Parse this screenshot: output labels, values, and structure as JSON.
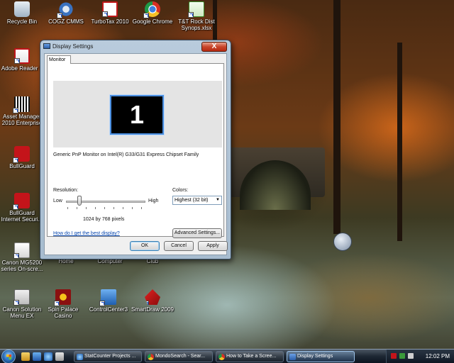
{
  "desktop": {
    "icons": [
      {
        "label": "Recycle Bin"
      },
      {
        "label": "COGZ CMMS"
      },
      {
        "label": "TurboTax 2010"
      },
      {
        "label": "Google Chrome"
      },
      {
        "label": "T&T Rock Dist Synops.xlsx"
      },
      {
        "label": "Adobe Reader 9"
      },
      {
        "label": "Asset Manager 2010 Enterprise"
      },
      {
        "label": "BullGuard"
      },
      {
        "label": "BullGuard Internet Securi..."
      },
      {
        "label": "Canon MG5200 series On-scre..."
      },
      {
        "label": "Home"
      },
      {
        "label": "Computer"
      },
      {
        "label": "Club"
      },
      {
        "label": "Canon Solution Menu EX"
      },
      {
        "label": "Spin Palace Casino"
      },
      {
        "label": "ControlCenter3"
      },
      {
        "label": "SmartDraw 2009"
      }
    ]
  },
  "dialog": {
    "title": "Display Settings",
    "close_label": "X",
    "tab_label": "Monitor",
    "monitor_number": "1",
    "monitor_description": "Generic PnP Monitor on Intel(R) G33/G31 Express Chipset Family",
    "resolution_label": "Resolution:",
    "low_label": "Low",
    "high_label": "High",
    "resolution_value": "1024 by 768 pixels",
    "colors_label": "Colors:",
    "colors_value": "Highest (32 bit)",
    "help_link": "How do I get the best display?",
    "advanced_button": "Advanced Settings...",
    "ok_button": "OK",
    "cancel_button": "Cancel",
    "apply_button": "Apply"
  },
  "taskbar": {
    "buttons": [
      {
        "label": "StatCounter Projects ...",
        "active": false
      },
      {
        "label": "MondoSearch - Sear...",
        "active": false
      },
      {
        "label": "How to Take a Scree...",
        "active": false
      },
      {
        "label": "Display Settings",
        "active": true
      }
    ],
    "clock": "12:02 PM"
  }
}
